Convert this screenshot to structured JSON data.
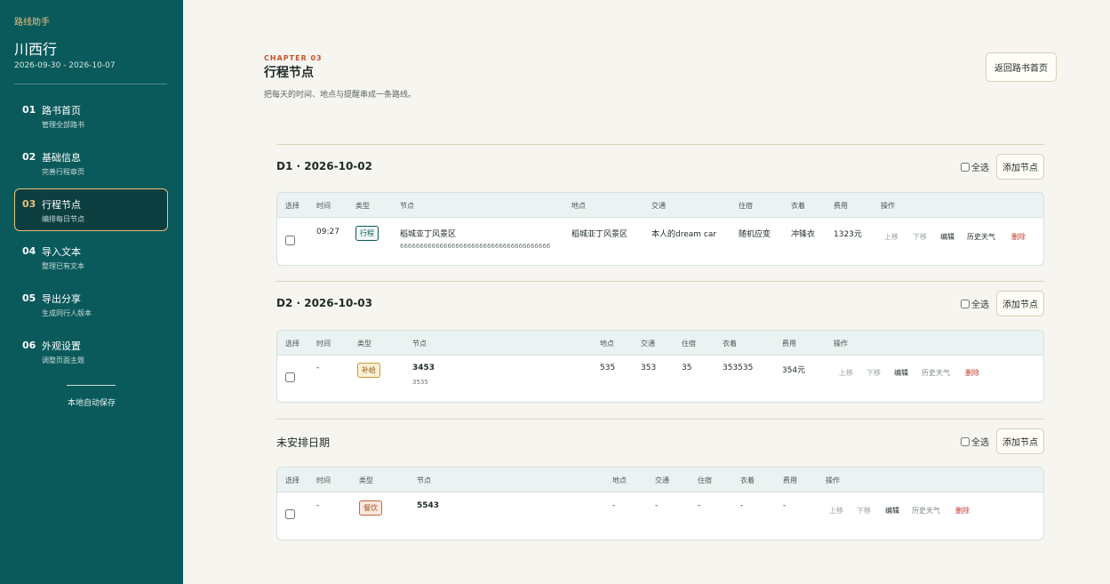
{
  "sidebar": {
    "brand": "路线助手",
    "trip_title": "川西行",
    "trip_dates": "2026-09-30 - 2026-10-07",
    "items": [
      {
        "num": "01",
        "label": "路书首页",
        "sub": "管理全部路书"
      },
      {
        "num": "02",
        "label": "基础信息",
        "sub": "完善行程章页"
      },
      {
        "num": "03",
        "label": "行程节点",
        "sub": "编排每日节点"
      },
      {
        "num": "04",
        "label": "导入文本",
        "sub": "整理已有文本"
      },
      {
        "num": "05",
        "label": "导出分享",
        "sub": "生成同行人版本"
      },
      {
        "num": "06",
        "label": "外观设置",
        "sub": "调整页面主题"
      }
    ],
    "active_index": 2,
    "autosave": "本地自动保存"
  },
  "header": {
    "chapter": "CHAPTER 03",
    "title": "行程节点",
    "desc": "把每天的时间、地点与提醒串成一条路线。",
    "back_label": "返回路书首页"
  },
  "common": {
    "select_all": "全选",
    "add_node": "添加节点",
    "columns": [
      "选择",
      "时间",
      "类型",
      "节点",
      "地点",
      "交通",
      "住宿",
      "衣着",
      "费用",
      "操作"
    ],
    "ops": [
      "上移",
      "下移",
      "编辑",
      "历史天气",
      "删除"
    ]
  },
  "days": [
    {
      "title": "D1 · 2026-10-02",
      "row": {
        "time": "09:27",
        "type": "行程",
        "node": "稻城亚丁风景区",
        "note": "66666666666666666666666666666666666666",
        "place": "稻城亚丁风景区",
        "transport": "本人的dream car",
        "stay": "随机应变",
        "wear": "冲锋衣",
        "cost": "1323元"
      }
    },
    {
      "title": "D2 · 2026-10-03",
      "row": {
        "time": "-",
        "type": "补给",
        "node": "3453",
        "note": "3535",
        "place": "535",
        "transport": "353",
        "stay": "35",
        "wear": "353535",
        "cost": "354元"
      }
    },
    {
      "title": "未安排日期",
      "row": {
        "time": "-",
        "type": "餐饮",
        "node": "5543",
        "note": "",
        "place": "-",
        "transport": "-",
        "stay": "-",
        "wear": "-",
        "cost": "-"
      }
    }
  ],
  "colors": {
    "sidebar_bg": "#0a5a5c",
    "accent_gold": "#e8c27a",
    "chapter_red": "#c2542d",
    "danger": "#c23b2b"
  }
}
